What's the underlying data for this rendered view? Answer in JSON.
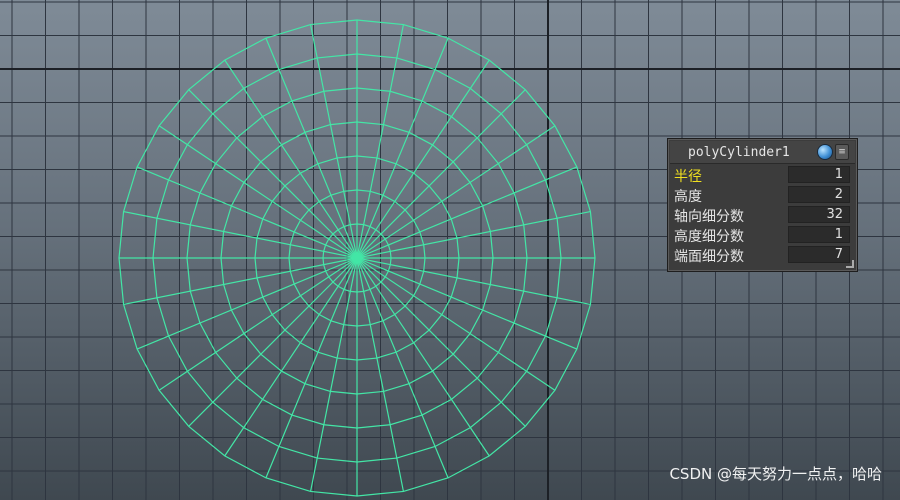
{
  "viewport": {
    "grid_color": "#2e3540",
    "wire_color": "#43e6a6",
    "axis_divisions": 32,
    "cap_divisions": 7
  },
  "channel_box": {
    "title": "polyCylinder1",
    "menu_glyph": "≡",
    "attributes": [
      {
        "label": "半径",
        "value": "1",
        "highlight": true
      },
      {
        "label": "高度",
        "value": "2",
        "highlight": false
      },
      {
        "label": "轴向细分数",
        "value": "32",
        "highlight": false
      },
      {
        "label": "高度细分数",
        "value": "1",
        "highlight": false
      },
      {
        "label": "端面细分数",
        "value": "7",
        "highlight": false
      }
    ]
  },
  "watermark": "CSDN @每天努力一点点，哈哈"
}
